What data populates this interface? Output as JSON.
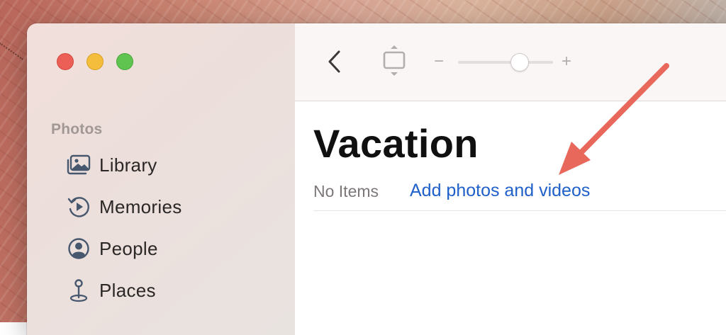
{
  "window": {
    "title_lights": [
      "close",
      "minimize",
      "maximize"
    ]
  },
  "toolbar": {
    "back_icon": "chevron-left-icon",
    "fit_icon": "fit-to-window-icon",
    "zoom_minus": "−",
    "zoom_plus": "+",
    "zoom_level": 0.65
  },
  "sidebar": {
    "section_title": "Photos",
    "items": [
      {
        "label": "Library",
        "icon": "library-photos-icon"
      },
      {
        "label": "Memories",
        "icon": "memories-play-icon"
      },
      {
        "label": "People",
        "icon": "person-icon"
      },
      {
        "label": "Places",
        "icon": "map-pin-icon"
      }
    ]
  },
  "album": {
    "title": "Vacation",
    "count_text": "No Items",
    "add_link": "Add photos and videos"
  },
  "colors": {
    "link": "#2060c9",
    "annotation_arrow": "#e8695b",
    "close": "#ec5f57",
    "minimize": "#f4bd3c",
    "maximize": "#5fc450"
  }
}
